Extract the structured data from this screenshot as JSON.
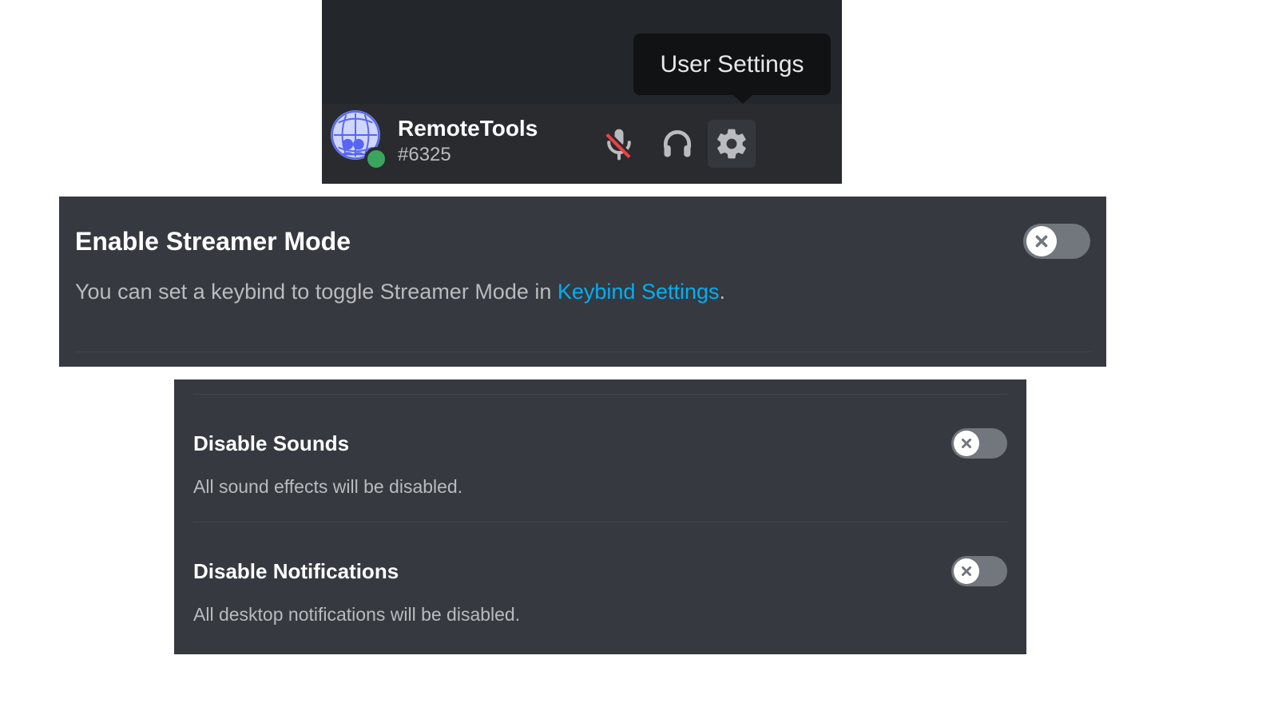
{
  "tooltip": {
    "label": "User Settings"
  },
  "user": {
    "name": "RemoteTools",
    "discriminator": "#6325",
    "status": "online"
  },
  "icons": {
    "mute": "mic-muted-icon",
    "deafen": "headphones-icon",
    "settings": "gear-icon",
    "avatar": "globe-people-icon",
    "toggle_off": "x-circle-icon"
  },
  "streamer_mode": {
    "title": "Enable Streamer Mode",
    "desc_prefix": "You can set a keybind to toggle Streamer Mode in ",
    "link": "Keybind Settings",
    "desc_suffix": ".",
    "enabled": false
  },
  "options": [
    {
      "title": "Disable Sounds",
      "desc": "All sound effects will be disabled.",
      "enabled": false
    },
    {
      "title": "Disable Notifications",
      "desc": "All desktop notifications will be disabled.",
      "enabled": false
    }
  ]
}
